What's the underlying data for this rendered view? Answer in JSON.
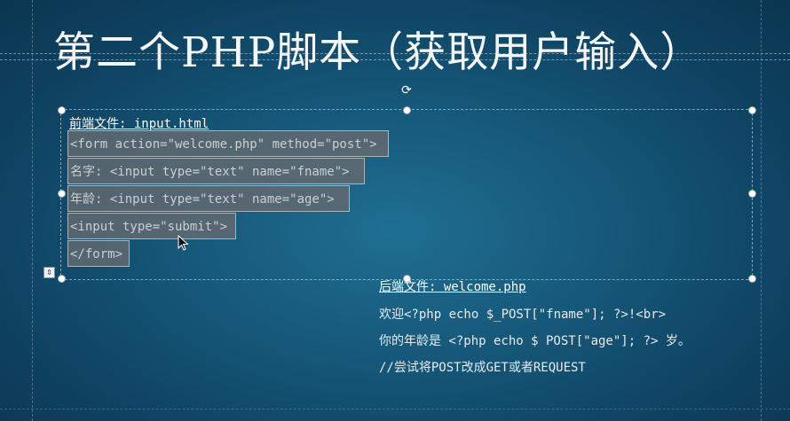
{
  "slide": {
    "title": "第二个PHP脚本（获取用户输入）"
  },
  "frontend": {
    "label": "前端文件: input.html",
    "lines": [
      "<form action=\"welcome.php\" method=\"post\">",
      "名字: <input type=\"text\" name=\"fname\">",
      "年龄: <input type=\"text\" name=\"age\">",
      "<input type=\"submit\">",
      "</form>"
    ]
  },
  "backend": {
    "label": "后端文件: welcome.php",
    "lines": [
      "欢迎<?php echo $_POST[\"fname\"]; ?>!<br>",
      "你的年龄是 <?php echo $ POST[\"age\"]; ?>  岁。",
      "//尝试将POST改成GET或者REQUEST"
    ]
  },
  "icons": {
    "rotate": "rotate-handle-icon",
    "autofit": "autofit-options-icon",
    "pointer": "mouse-pointer-icon"
  },
  "colors": {
    "background": "#175a7c",
    "code_highlight": "#5f6970"
  }
}
